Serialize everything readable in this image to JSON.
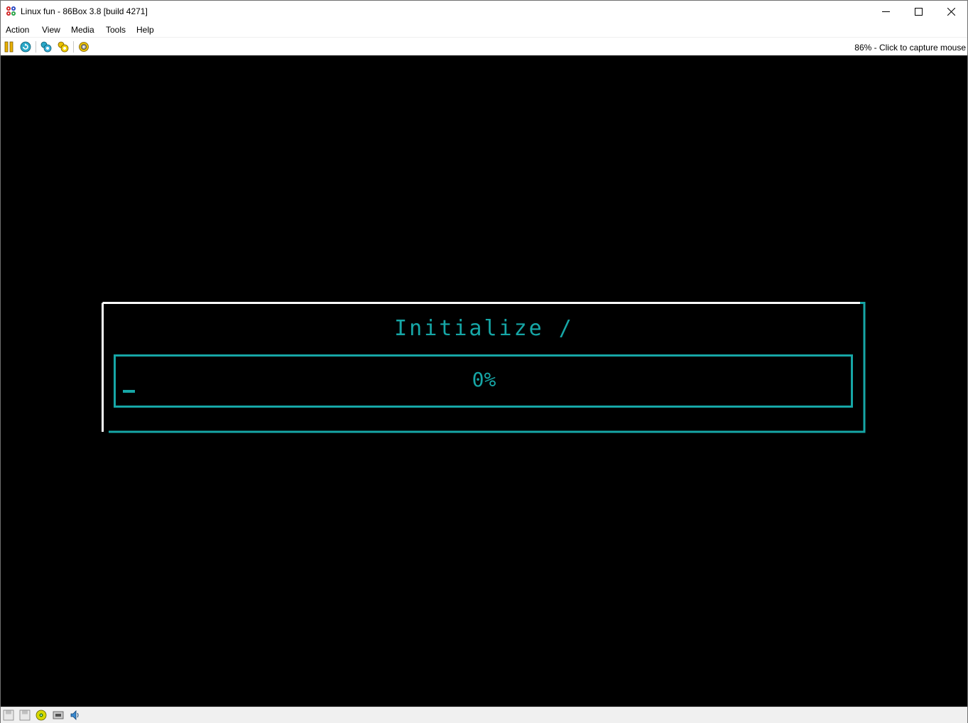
{
  "window": {
    "title": "Linux fun - 86Box 3.8 [build 4271]"
  },
  "menu": {
    "items": [
      "Action",
      "View",
      "Media",
      "Tools",
      "Help"
    ]
  },
  "toolbar": {
    "icons": [
      "pause-icon",
      "reset-icon",
      "ctrl-alt-del-icon",
      "ctrl-alt-esc-icon",
      "settings-icon"
    ],
    "capture_hint": "86% - Click to capture mouse"
  },
  "screen": {
    "title": "Initialize /",
    "progress_label": "0%",
    "progress_value": 0,
    "colors": {
      "text": "#16a6a6",
      "frame_highlight": "#ffffff",
      "background": "#000000"
    }
  },
  "statusbar": {
    "icons": [
      "floppy-drive-1-icon",
      "floppy-drive-2-icon",
      "cdrom-icon",
      "network-icon",
      "sound-icon"
    ]
  }
}
